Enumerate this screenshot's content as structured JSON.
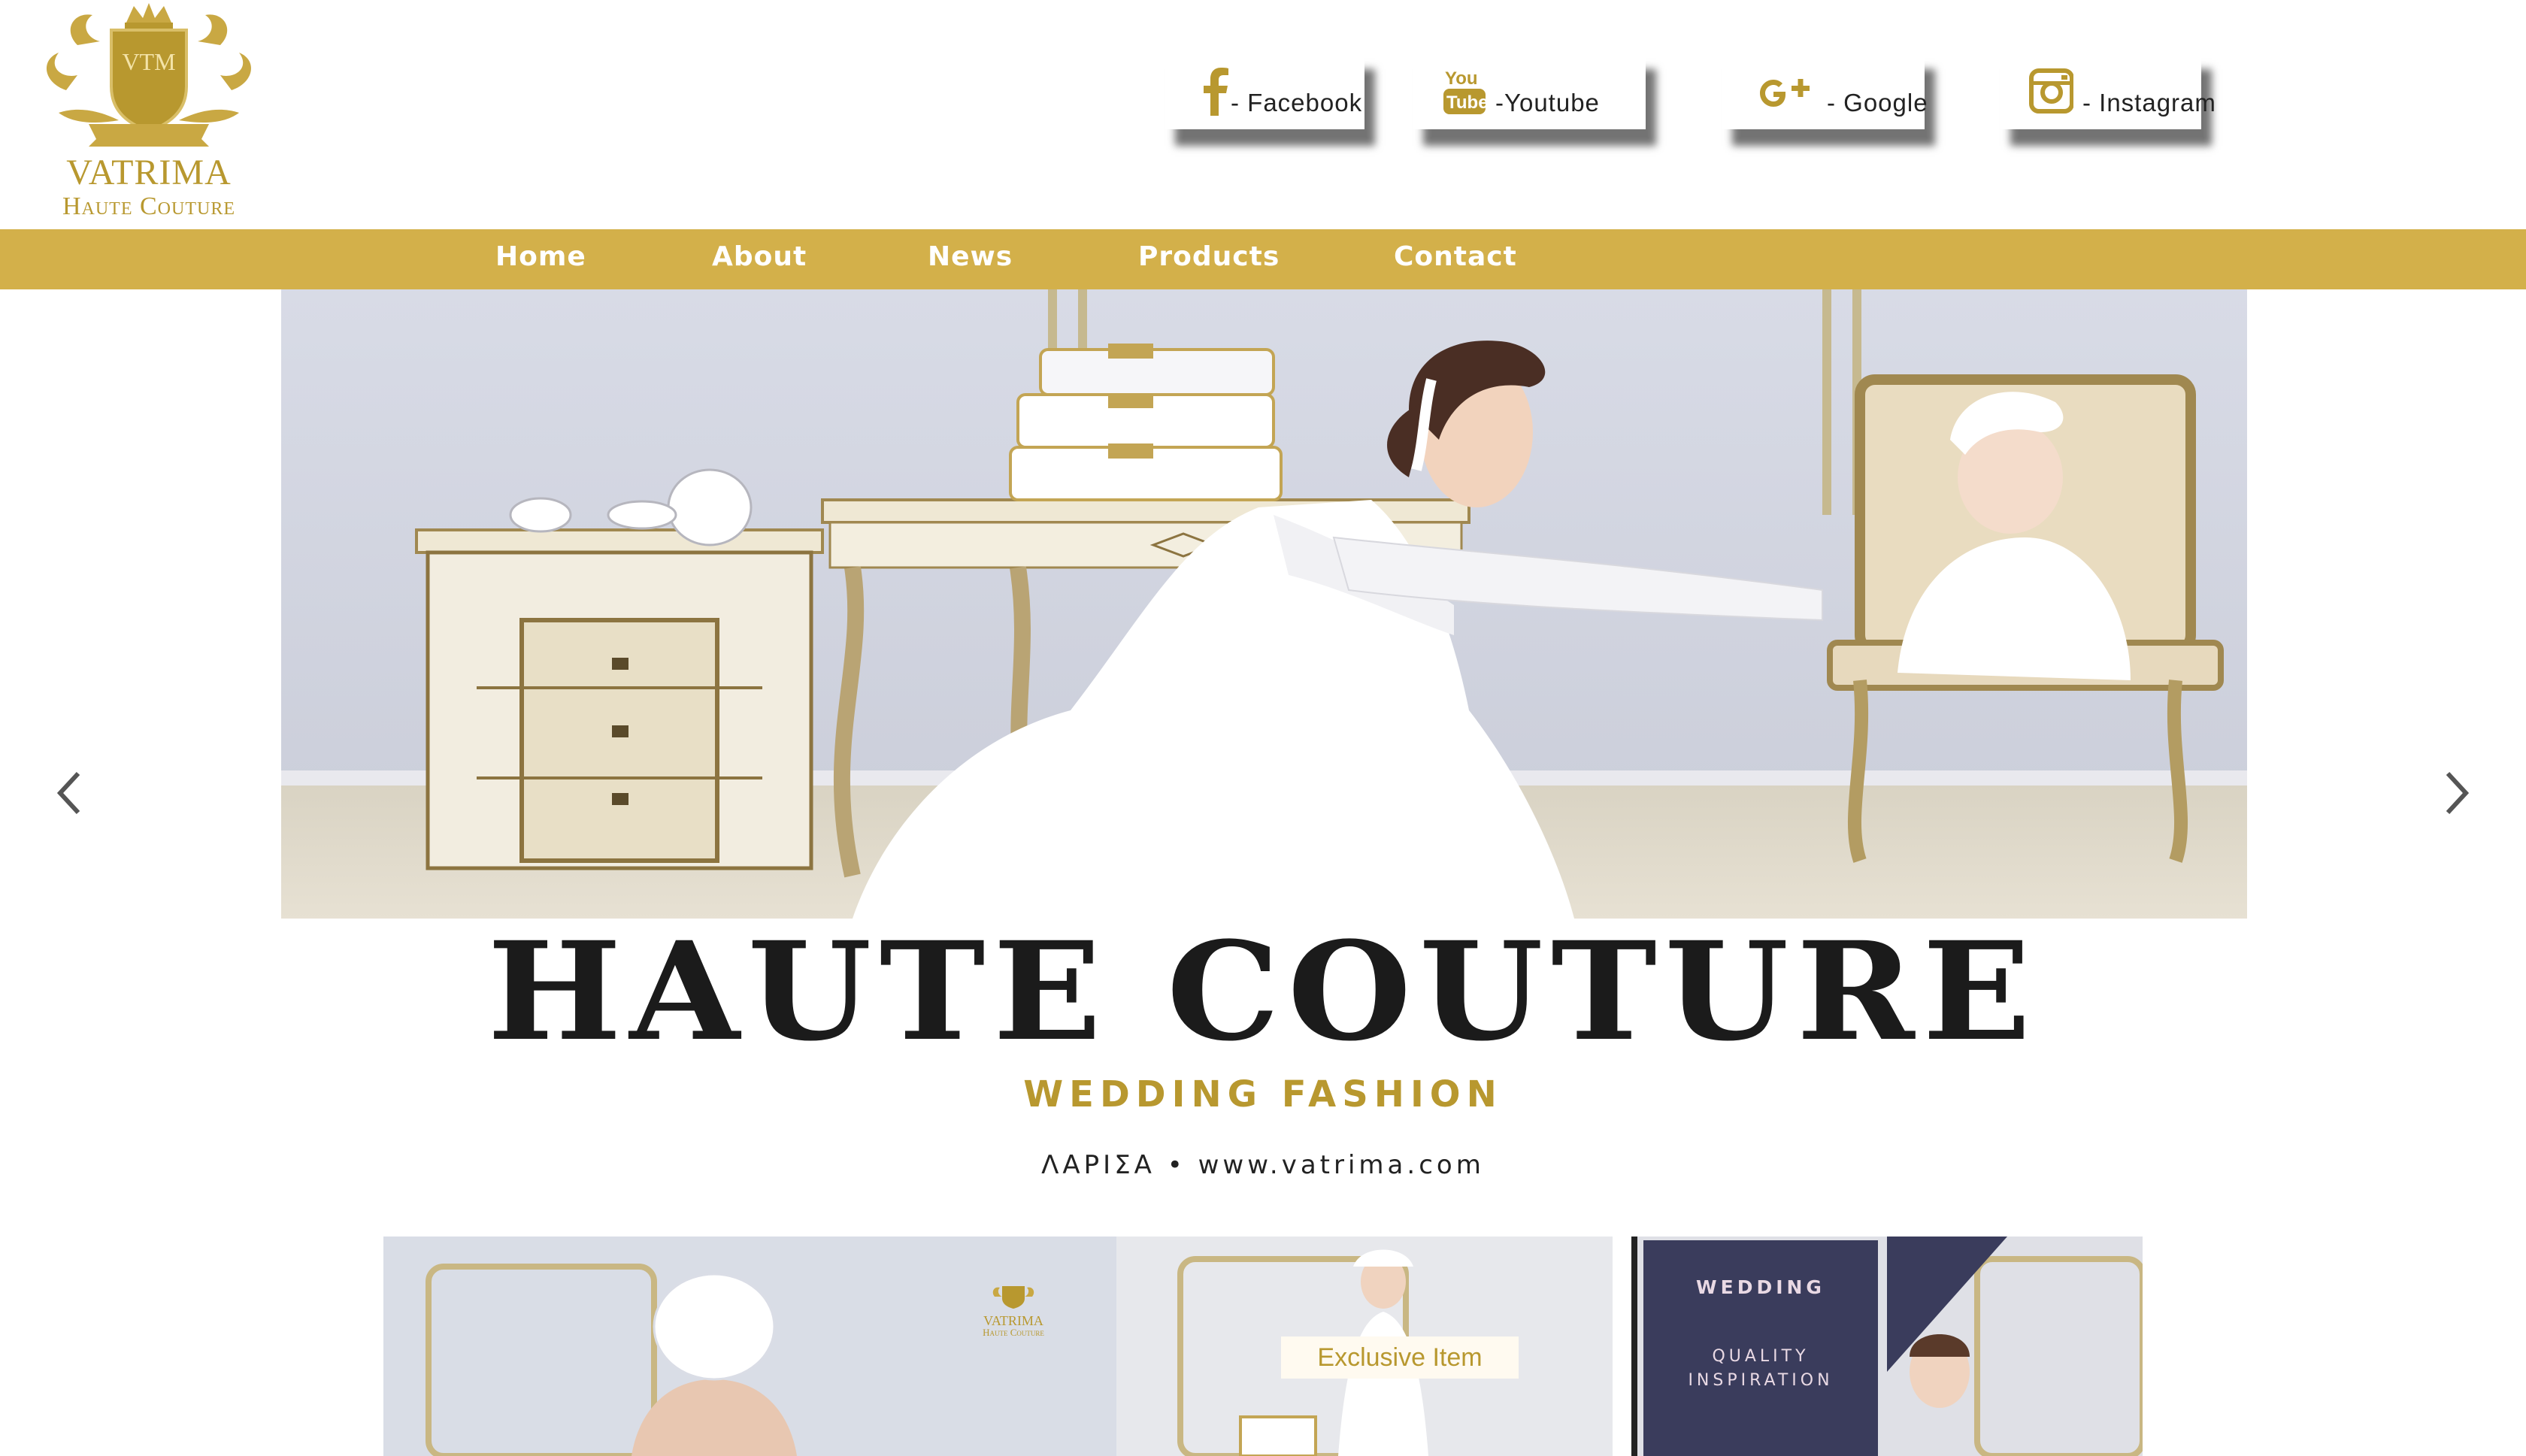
{
  "brand": {
    "monogram": "VTM",
    "name": "VATRIMA",
    "tagline": "Haute Couture"
  },
  "social": [
    {
      "icon": "facebook-icon",
      "label": "- Facebook"
    },
    {
      "icon": "youtube-icon",
      "label": "-Youtube"
    },
    {
      "icon": "google-plus-icon",
      "label": "- Google"
    },
    {
      "icon": "instagram-icon",
      "label": "- Instagram"
    }
  ],
  "nav": [
    "Home",
    "About",
    "News",
    "Products",
    "Contact"
  ],
  "hero": {
    "prev": "chevron-left-icon",
    "next": "chevron-right-icon"
  },
  "headline": {
    "title": "HAUTE COUTURE",
    "subtitle": "WEDDING FASHION",
    "location": "ΛΑΡΙΣΑ • www.vatrima.com"
  },
  "strip": {
    "badge": "Exclusive Item",
    "logo_name": "VATRIMA",
    "logo_tag": "Haute Couture",
    "box_title": "WEDDING",
    "box_line1": "QUALITY",
    "box_line2": "INSPIRATION"
  },
  "colors": {
    "gold": "#d3b04a",
    "gold_text": "#b8982f",
    "navy": "#3a3c5c"
  }
}
